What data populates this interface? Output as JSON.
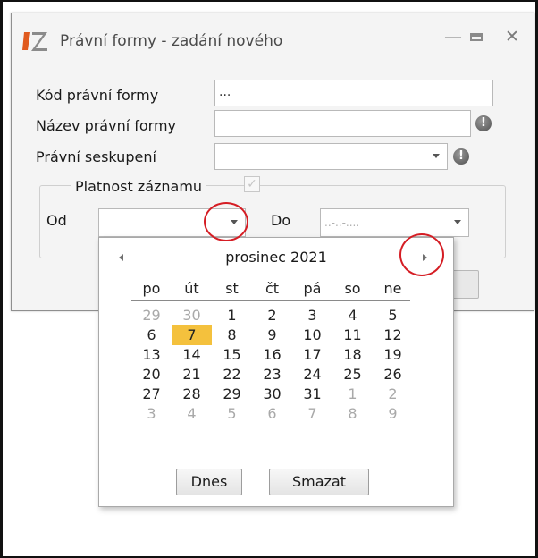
{
  "window": {
    "title": "Právní formy - zadání nového",
    "minimize_glyph": "—",
    "close_glyph": "✕"
  },
  "form": {
    "kod_label": "Kód právní formy",
    "kod_value": "...",
    "nazev_label": "Název právní formy",
    "nazev_value": "",
    "seskupeni_label": "Právní seskupení",
    "seskupeni_value": "",
    "info_glyph": "!",
    "platnost_label": "Platnost záznamu",
    "platnost_checked": "✓",
    "od_label": "Od",
    "od_value": "",
    "do_label": "Do",
    "do_placeholder": "..-..-...."
  },
  "calendar": {
    "month": "prosinec 2021",
    "weekdays": [
      "po",
      "út",
      "st",
      "čt",
      "pá",
      "so",
      "ne"
    ],
    "weeks": [
      [
        "29",
        "30",
        "1",
        "2",
        "3",
        "4",
        "5"
      ],
      [
        "6",
        "7",
        "8",
        "9",
        "10",
        "11",
        "12"
      ],
      [
        "13",
        "14",
        "15",
        "16",
        "17",
        "18",
        "19"
      ],
      [
        "20",
        "21",
        "22",
        "23",
        "24",
        "25",
        "26"
      ],
      [
        "27",
        "28",
        "29",
        "30",
        "31",
        "1",
        "2"
      ],
      [
        "3",
        "4",
        "5",
        "6",
        "7",
        "8",
        "9"
      ]
    ],
    "today_button": "Dnes",
    "clear_button": "Smazat"
  },
  "colors": {
    "highlight": "#f4c13d",
    "annotation_red": "#d51d24",
    "logo_orange": "#e05a1e",
    "logo_grey": "#8b8b8b"
  }
}
